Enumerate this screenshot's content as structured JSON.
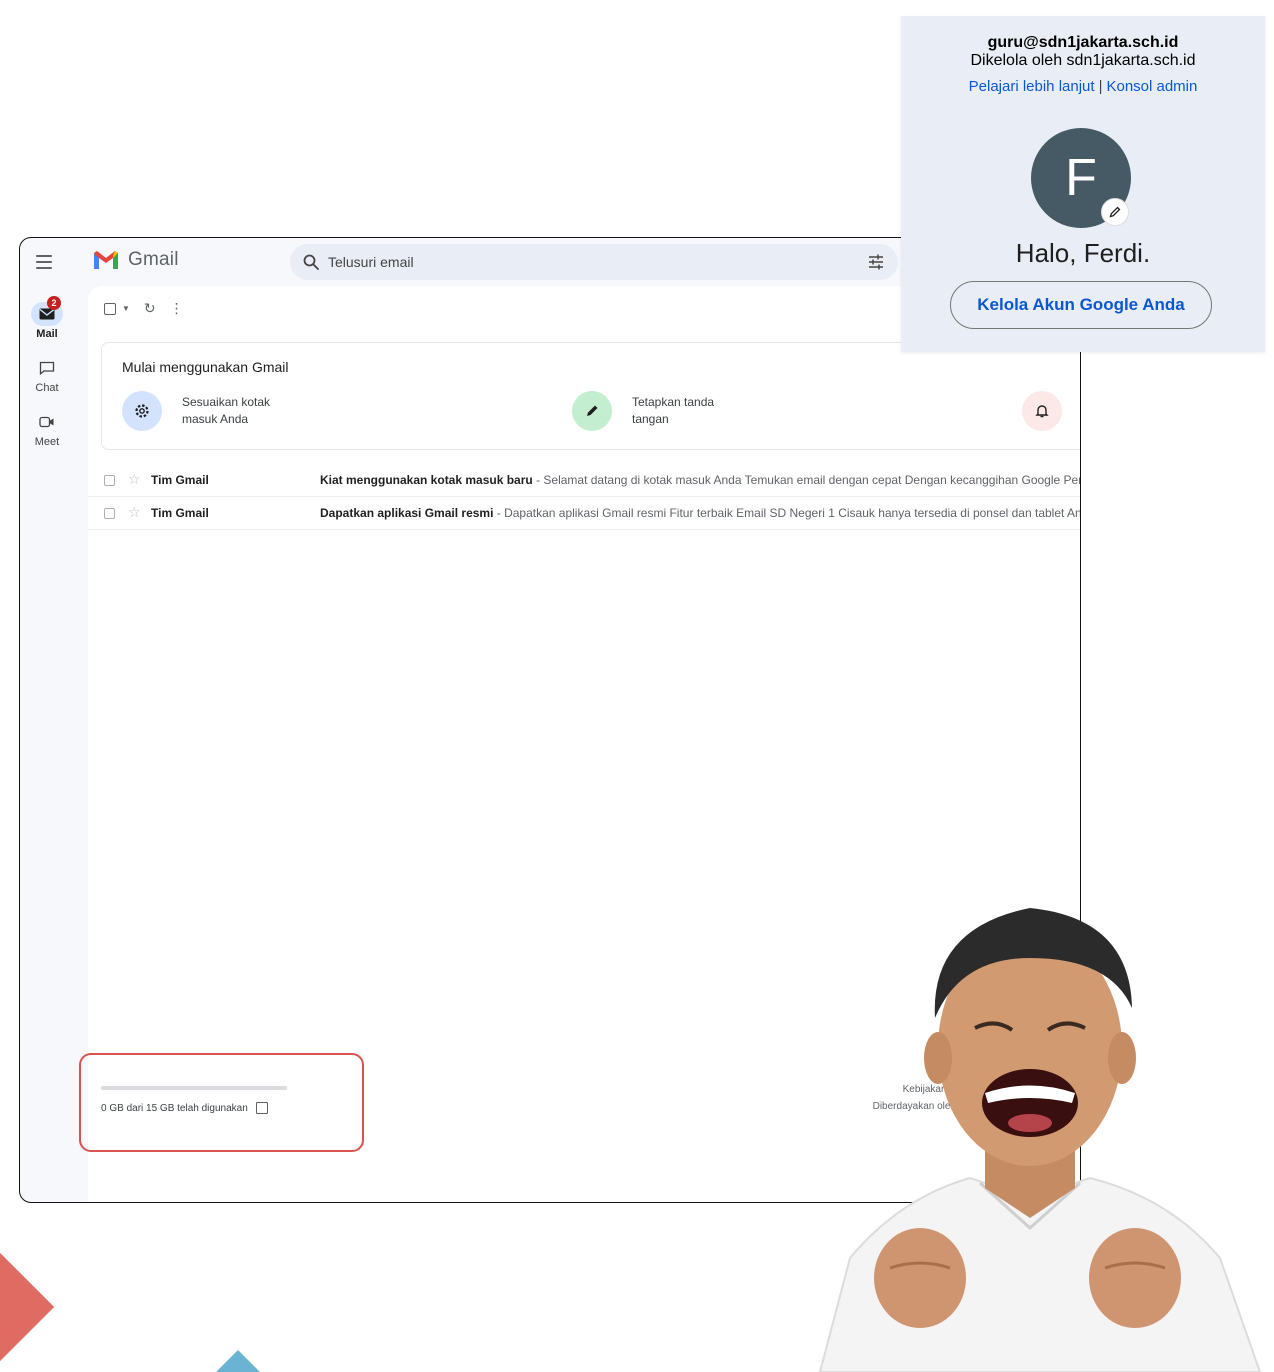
{
  "gmail": {
    "app_name": "Gmail",
    "search_placeholder": "Telusuri email",
    "rail": [
      {
        "label": "Mail",
        "badge": "2"
      },
      {
        "label": "Chat"
      },
      {
        "label": "Meet"
      }
    ],
    "getting_started": {
      "title": "Mulai menggunakan Gmail",
      "items": [
        {
          "label_line1": "Sesuaikan kotak",
          "label_line2": "masuk Anda"
        },
        {
          "label_line1": "Tetapkan tanda",
          "label_line2": "tangan"
        }
      ]
    },
    "emails": [
      {
        "sender": "Tim Gmail",
        "subject": "Kiat menggunakan kotak masuk baru",
        "snippet": " - Selamat datang di kotak masuk Anda Temukan email dengan cepat Dengan kecanggihan Google Pen"
      },
      {
        "sender": "Tim Gmail",
        "subject": "Dapatkan aplikasi Gmail resmi",
        "snippet": " - Dapatkan aplikasi Gmail resmi Fitur terbaik Email SD Negeri 1 Cisauk hanya tersedia di ponsel dan tablet And"
      }
    ],
    "storage": {
      "text": "0 GB dari 15 GB telah digunakan",
      "used_fraction": 0
    },
    "footer": {
      "line1": "Kebijakan P",
      "line2": "Diberdayakan oleh"
    }
  },
  "account": {
    "email": "guru@sdn1jakarta.sch.id",
    "managed_by": "Dikelola oleh sdn1jakarta.sch.id",
    "learn_more": "Pelajari lebih lanjut",
    "separator": "|",
    "admin_console": "Konsol admin",
    "avatar_letter": "F",
    "avatar_color": "#455a64",
    "greeting": "Halo, Ferdi.",
    "manage_button": "Kelola Akun Google Anda"
  },
  "colors": {
    "accent_blue": "#0b57d0",
    "highlight_red": "#d9534f",
    "badge_red": "#c5221f",
    "deco_coral": "#e06b62",
    "deco_sky": "#6bb3d2"
  }
}
